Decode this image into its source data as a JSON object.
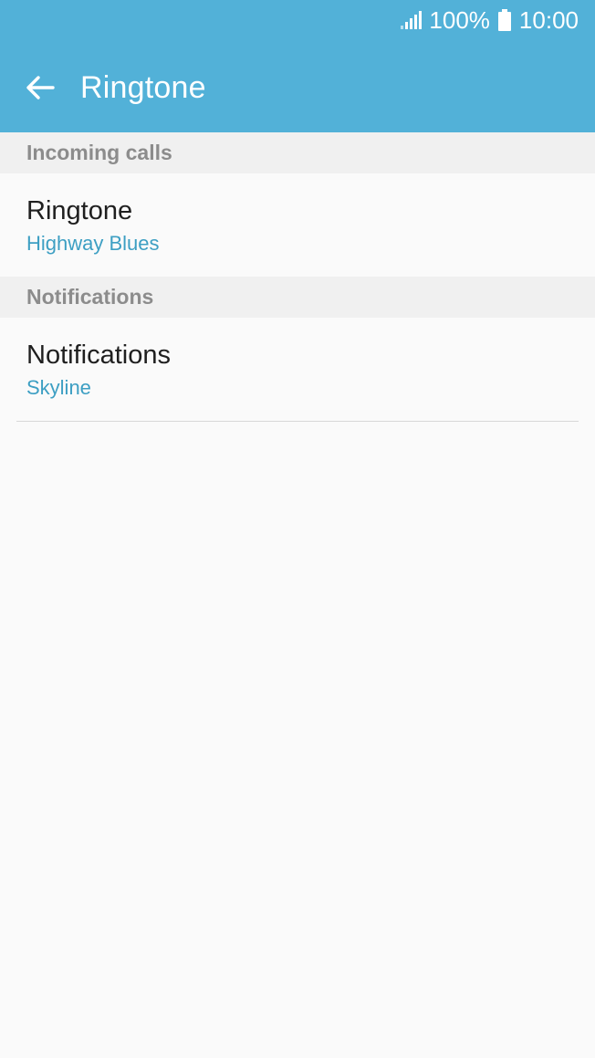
{
  "status_bar": {
    "battery_percent": "100%",
    "time": "10:00"
  },
  "header": {
    "title": "Ringtone",
    "back_icon": "arrow-left-icon"
  },
  "sections": [
    {
      "header": "Incoming calls",
      "item": {
        "title": "Ringtone",
        "value": "Highway Blues"
      }
    },
    {
      "header": "Notifications",
      "item": {
        "title": "Notifications",
        "value": "Skyline"
      }
    }
  ],
  "colors": {
    "appbar": "#52b1d8",
    "accent_text": "#3d9fc3",
    "section_bg": "#f0f0f0",
    "background": "#fafafa"
  }
}
